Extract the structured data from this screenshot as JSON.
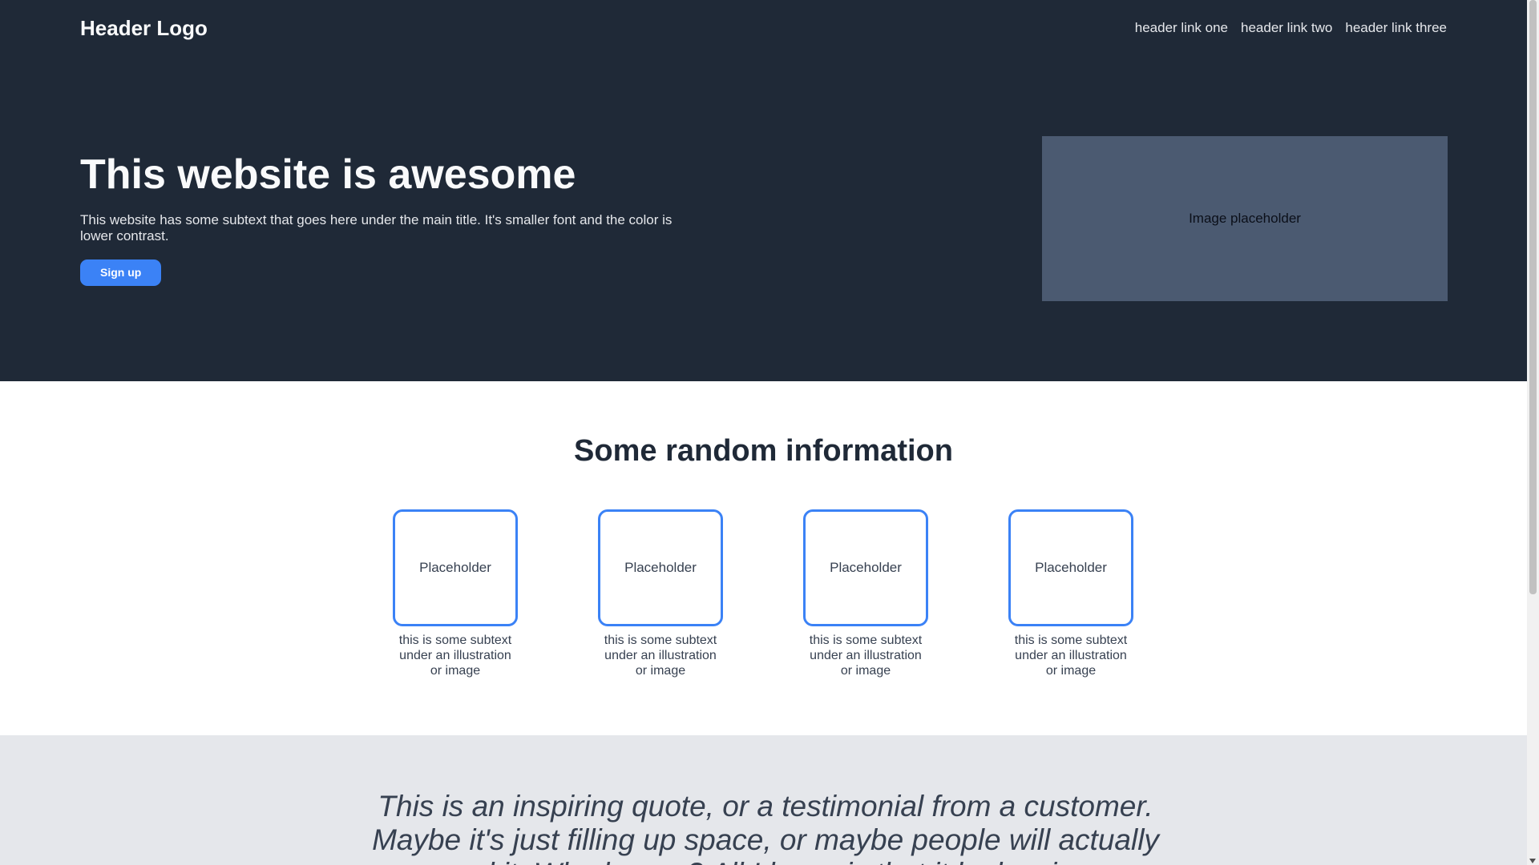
{
  "header": {
    "logo": "Header Logo",
    "links": [
      "header link one",
      "header link two",
      "header link three"
    ]
  },
  "hero": {
    "title": "This website is awesome",
    "subtext": "This website has some subtext that goes here under the main title. It's smaller font and the color is lower contrast.",
    "signup_label": "Sign up",
    "image_label": "Image placeholder"
  },
  "info": {
    "title": "Some random information",
    "items": [
      {
        "label": "Placeholder",
        "caption": "this is some subtext under an illustration or image"
      },
      {
        "label": "Placeholder",
        "caption": "this is some subtext under an illustration or image"
      },
      {
        "label": "Placeholder",
        "caption": "this is some subtext under an illustration or image"
      },
      {
        "label": "Placeholder",
        "caption": "this is some subtext under an illustration or image"
      }
    ]
  },
  "quote": {
    "text": "This is an inspiring quote, or a testimonial from a customer. Maybe it's just filling up space, or maybe people will actually read it. Who knows? All I know is that it looks nice."
  },
  "colors": {
    "header_bg": "#1f2937",
    "accent": "#3b82f6",
    "image_placeholder": "#4b5a71",
    "quote_bg": "#e5e7eb"
  }
}
